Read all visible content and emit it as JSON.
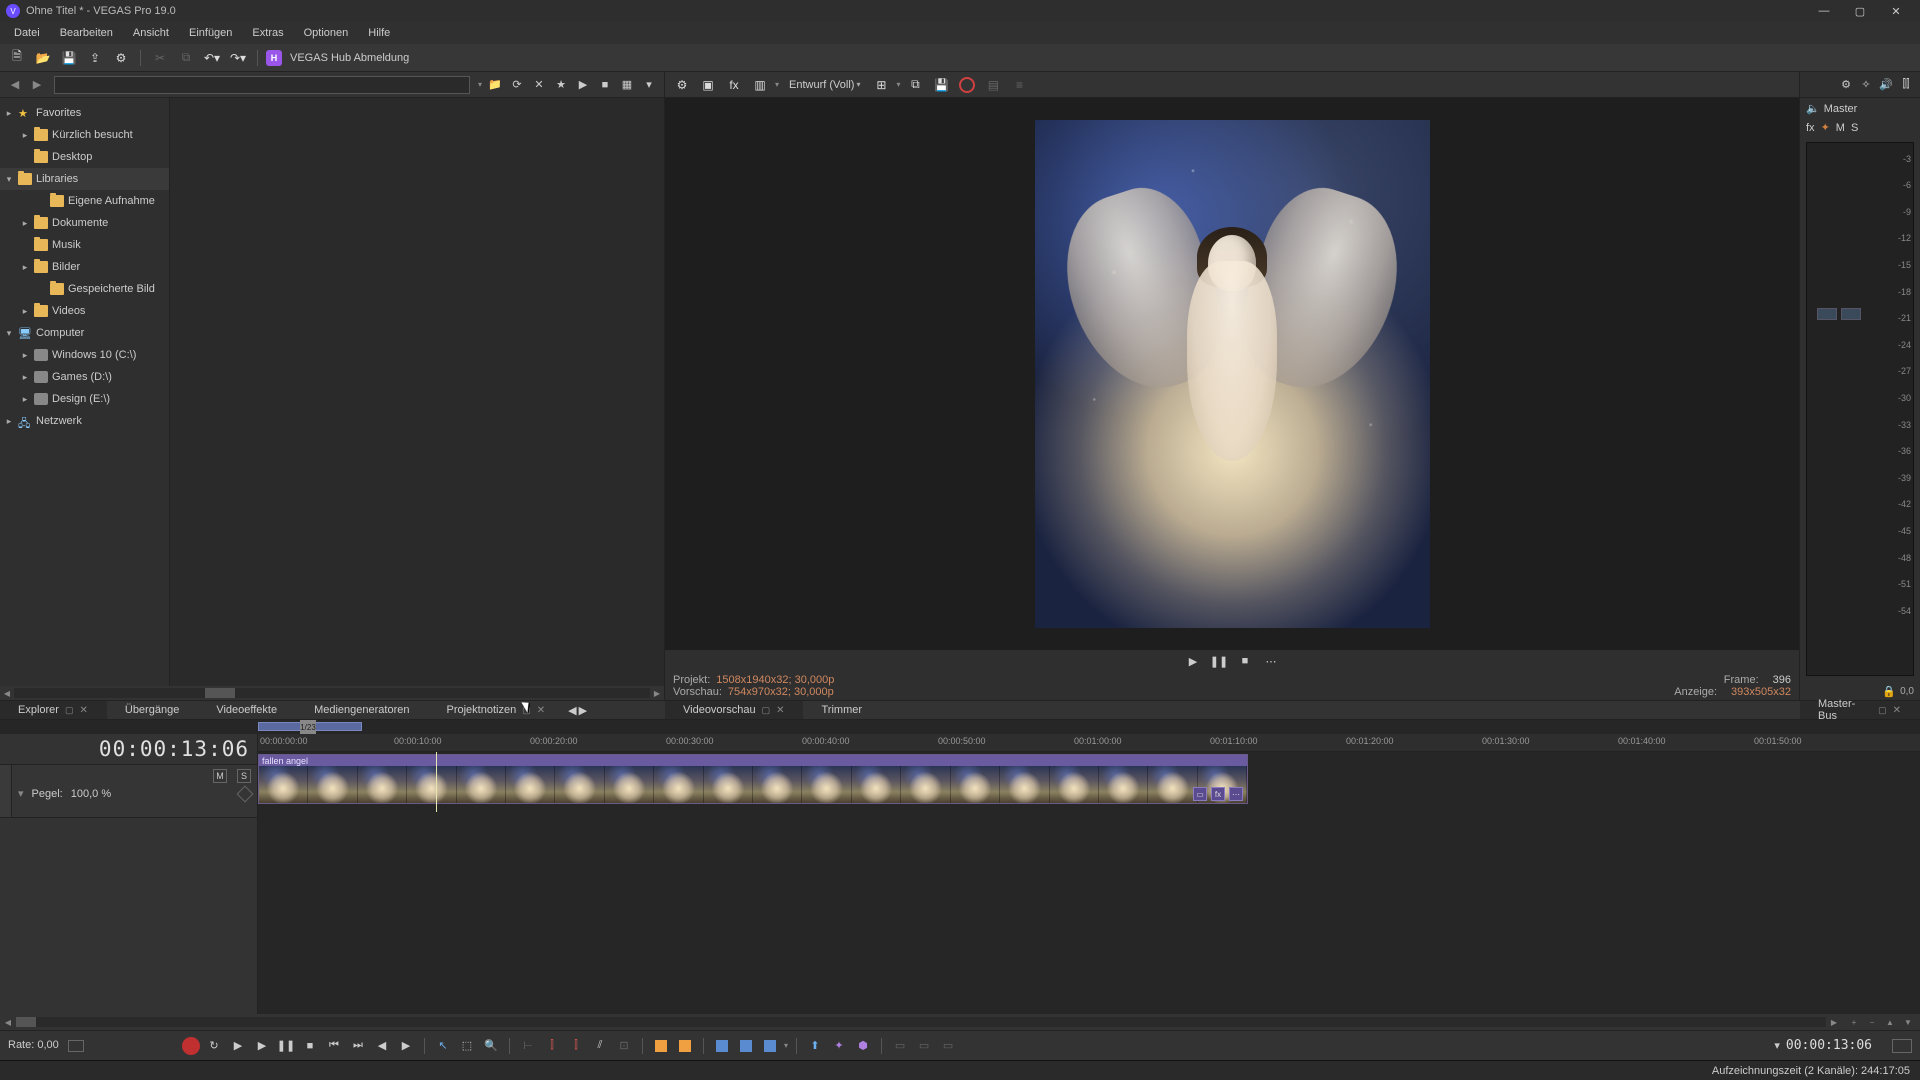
{
  "app": {
    "title": "Ohne Titel * - VEGAS Pro 19.0",
    "icon_letter": "V"
  },
  "menu": [
    "Datei",
    "Bearbeiten",
    "Ansicht",
    "Einfügen",
    "Extras",
    "Optionen",
    "Hilfe"
  ],
  "hub": {
    "badge": "H",
    "label": "VEGAS Hub Abmeldung"
  },
  "explorer": {
    "tree": [
      {
        "label": "Favorites",
        "icon": "star",
        "indent": 0,
        "expander": "▸"
      },
      {
        "label": "Kürzlich besucht",
        "icon": "folder",
        "indent": 1,
        "expander": "▸"
      },
      {
        "label": "Desktop",
        "icon": "folder",
        "indent": 1,
        "expander": ""
      },
      {
        "label": "Libraries",
        "icon": "folder",
        "indent": 0,
        "expander": "▾"
      },
      {
        "label": "Eigene Aufnahme",
        "icon": "folder",
        "indent": 2,
        "expander": ""
      },
      {
        "label": "Dokumente",
        "icon": "folder",
        "indent": 1,
        "expander": "▸"
      },
      {
        "label": "Musik",
        "icon": "folder",
        "indent": 1,
        "expander": ""
      },
      {
        "label": "Bilder",
        "icon": "folder",
        "indent": 1,
        "expander": "▸"
      },
      {
        "label": "Gespeicherte Bild",
        "icon": "folder",
        "indent": 2,
        "expander": ""
      },
      {
        "label": "Videos",
        "icon": "folder",
        "indent": 1,
        "expander": "▸"
      },
      {
        "label": "Computer",
        "icon": "pc",
        "indent": 0,
        "expander": "▾"
      },
      {
        "label": "Windows 10 (C:\\)",
        "icon": "drive",
        "indent": 1,
        "expander": "▸"
      },
      {
        "label": "Games (D:\\)",
        "icon": "drive",
        "indent": 1,
        "expander": "▸"
      },
      {
        "label": "Design (E:\\)",
        "icon": "drive",
        "indent": 1,
        "expander": "▸"
      },
      {
        "label": "Netzwerk",
        "icon": "pc",
        "indent": 0,
        "expander": "▸"
      }
    ]
  },
  "preview": {
    "quality": "Entwurf (Voll)",
    "info": {
      "projekt_label": "Projekt:",
      "projekt_value": "1508x1940x32; 30,000p",
      "vorschau_label": "Vorschau:",
      "vorschau_value": "754x970x32; 30,000p",
      "frame_label": "Frame:",
      "frame_value": "396",
      "anzeige_label": "Anzeige:",
      "anzeige_value": "393x505x32"
    }
  },
  "panel_tabs_left": [
    "Explorer",
    "Übergänge",
    "Videoeffekte",
    "Mediengeneratoren",
    "Projektnotizen"
  ],
  "panel_tabs_right": [
    "Videovorschau",
    "Trimmer"
  ],
  "panel_tab_master": "Master-Bus",
  "master": {
    "title": "Master",
    "sub": [
      "fx",
      "✦",
      "M",
      "S"
    ],
    "db_ticks": [
      "-3",
      "-6",
      "-9",
      "-12",
      "-15",
      "-18",
      "-21",
      "-24",
      "-27",
      "-30",
      "-33",
      "-36",
      "-39",
      "-42",
      "-45",
      "-48",
      "-51",
      "-54"
    ],
    "bottom_value": "0,0"
  },
  "timeline": {
    "overview_label": "1/23",
    "timecode": "00:00:13:06",
    "track": {
      "mute": "M",
      "solo": "S",
      "level_label": "Pegel:",
      "level_value": "100,0 %"
    },
    "clip_label": "fallen angel",
    "ruler_marks": [
      "00:00:00:00",
      "00:00:10:00",
      "00:00:20:00",
      "00:00:30:00",
      "00:00:40:00",
      "00:00:50:00",
      "00:01:00:00",
      "00:01:10:00",
      "00:01:20:00",
      "00:01:30:00",
      "00:01:40:00",
      "00:01:50:00"
    ]
  },
  "transport": {
    "rate_label": "Rate:",
    "rate_value": "0,00",
    "time": "00:00:13:06"
  },
  "statusbar": "Aufzeichnungszeit (2 Kanäle): 244:17:05"
}
